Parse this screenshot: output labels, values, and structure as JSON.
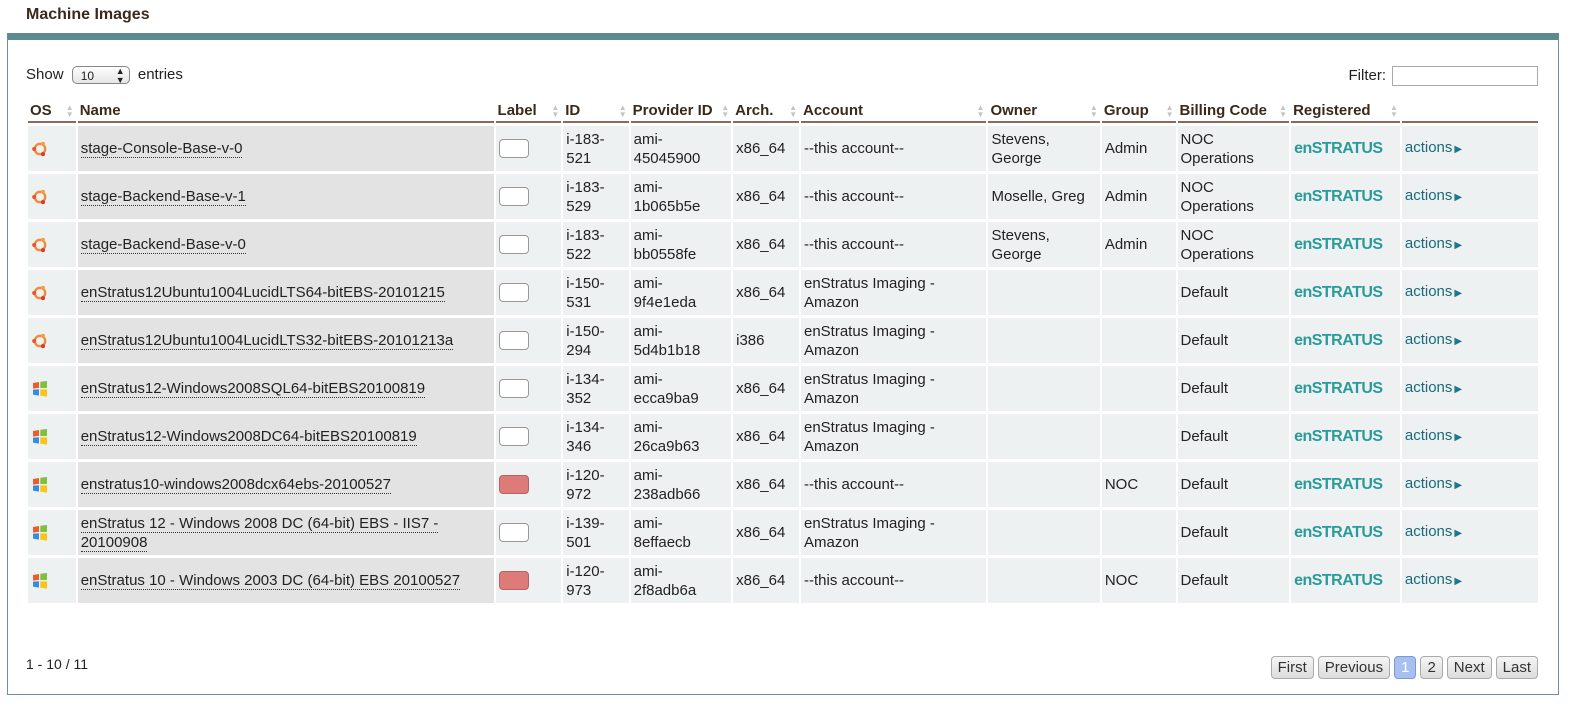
{
  "page_title": "Machine Images",
  "show": {
    "prefix": "Show",
    "value": "10",
    "suffix": "entries"
  },
  "filter": {
    "label": "Filter:",
    "value": ""
  },
  "columns": [
    "OS",
    "Name",
    "Label",
    "ID",
    "Provider ID",
    "Arch.",
    "Account",
    "Owner",
    "Group",
    "Billing Code",
    "Registered",
    ""
  ],
  "rows": [
    {
      "os": "ubuntu-icon",
      "name": "stage-Console-Base-v-0",
      "label": "white",
      "id": "i-183-521",
      "provider_id": "ami-45045900",
      "arch": "x86_64",
      "account": "--this account--",
      "owner": "Stevens, George",
      "group": "Admin",
      "billing": "NOC Operations",
      "registered": "enSTRATUS",
      "action": "actions"
    },
    {
      "os": "ubuntu-icon",
      "name": "stage-Backend-Base-v-1",
      "label": "white",
      "id": "i-183-529",
      "provider_id": "ami-1b065b5e",
      "arch": "x86_64",
      "account": "--this account--",
      "owner": "Moselle, Greg",
      "group": "Admin",
      "billing": "NOC Operations",
      "registered": "enSTRATUS",
      "action": "actions"
    },
    {
      "os": "ubuntu-icon",
      "name": "stage-Backend-Base-v-0",
      "label": "white",
      "id": "i-183-522",
      "provider_id": "ami-bb0558fe",
      "arch": "x86_64",
      "account": "--this account--",
      "owner": "Stevens, George",
      "group": "Admin",
      "billing": "NOC Operations",
      "registered": "enSTRATUS",
      "action": "actions"
    },
    {
      "os": "ubuntu-icon",
      "name": "enStratus12Ubuntu1004LucidLTS64-bitEBS-20101215",
      "label": "white",
      "id": "i-150-531",
      "provider_id": "ami-9f4e1eda",
      "arch": "x86_64",
      "account": "enStratus Imaging - Amazon",
      "owner": "",
      "group": "",
      "billing": "Default",
      "registered": "enSTRATUS",
      "action": "actions"
    },
    {
      "os": "ubuntu-icon",
      "name": "enStratus12Ubuntu1004LucidLTS32-bitEBS-20101213a",
      "label": "white",
      "id": "i-150-294",
      "provider_id": "ami-5d4b1b18",
      "arch": "i386",
      "account": "enStratus Imaging - Amazon",
      "owner": "",
      "group": "",
      "billing": "Default",
      "registered": "enSTRATUS",
      "action": "actions"
    },
    {
      "os": "windows-icon",
      "name": "enStratus12-Windows2008SQL64-bitEBS20100819",
      "label": "white",
      "id": "i-134-352",
      "provider_id": "ami-ecca9ba9",
      "arch": "x86_64",
      "account": "enStratus Imaging - Amazon",
      "owner": "",
      "group": "",
      "billing": "Default",
      "registered": "enSTRATUS",
      "action": "actions"
    },
    {
      "os": "windows-icon",
      "name": "enStratus12-Windows2008DC64-bitEBS20100819",
      "label": "white",
      "id": "i-134-346",
      "provider_id": "ami-26ca9b63",
      "arch": "x86_64",
      "account": "enStratus Imaging - Amazon",
      "owner": "",
      "group": "",
      "billing": "Default",
      "registered": "enSTRATUS",
      "action": "actions"
    },
    {
      "os": "windows-icon",
      "name": "enstratus10-windows2008dcx64ebs-20100527",
      "label": "red",
      "id": "i-120-972",
      "provider_id": "ami-238adb66",
      "arch": "x86_64",
      "account": "--this account--",
      "owner": "",
      "group": "NOC",
      "billing": "Default",
      "registered": "enSTRATUS",
      "action": "actions"
    },
    {
      "os": "windows-icon",
      "name": "enStratus 12 - Windows 2008 DC (64-bit) EBS - IIS7 - 20100908",
      "label": "white",
      "id": "i-139-501",
      "provider_id": "ami-8effaecb",
      "arch": "x86_64",
      "account": "enStratus Imaging - Amazon",
      "owner": "",
      "group": "",
      "billing": "Default",
      "registered": "enSTRATUS",
      "action": "actions"
    },
    {
      "os": "windows-icon",
      "name": "enStratus 10 - Windows 2003 DC (64-bit) EBS 20100527",
      "label": "red",
      "id": "i-120-973",
      "provider_id": "ami-2f8adb6a",
      "arch": "x86_64",
      "account": "--this account--",
      "owner": "",
      "group": "NOC",
      "billing": "Default",
      "registered": "enSTRATUS",
      "action": "actions"
    }
  ],
  "footer": {
    "count": "1 - 10 / 11"
  },
  "pagination": [
    "First",
    "Previous",
    "1",
    "2",
    "Next",
    "Last"
  ],
  "pagination_active": "1",
  "colors": {
    "header_bar": "#5b8a90",
    "label_red": "#dc7b78",
    "active_page": "#a8c0f0",
    "actions_link": "#1a6a7a"
  }
}
